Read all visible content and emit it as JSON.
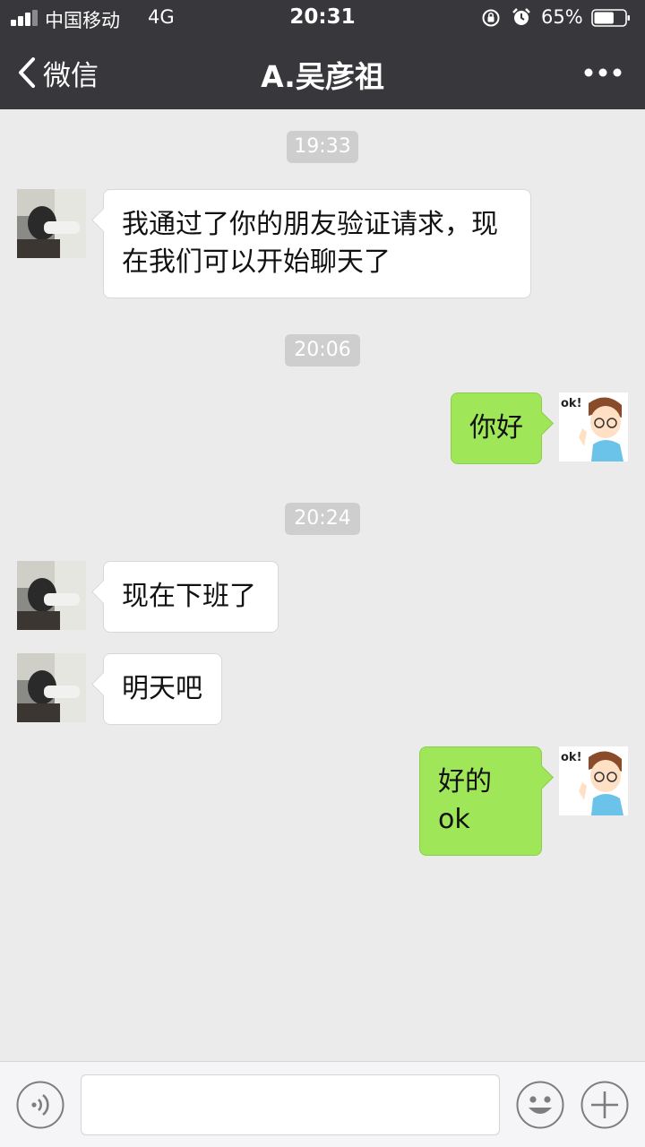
{
  "status_bar": {
    "carrier": "中国移动",
    "network": "4G",
    "time": "20:31",
    "battery_percent": "65%",
    "battery_level": 0.65,
    "signal_bars": 3
  },
  "nav": {
    "back_label": "微信",
    "title": "A.吴彦祖",
    "more_icon": "more-dots-icon"
  },
  "messages": [
    {
      "type": "timestamp",
      "text": "19:33"
    },
    {
      "type": "incoming",
      "text": "我通过了你的朋友验证请求，现在我们可以开始聊天了"
    },
    {
      "type": "timestamp",
      "text": "20:06"
    },
    {
      "type": "outgoing",
      "text": "你好"
    },
    {
      "type": "timestamp",
      "text": "20:24"
    },
    {
      "type": "incoming",
      "text": "现在下班了"
    },
    {
      "type": "incoming",
      "text": "明天吧"
    },
    {
      "type": "outgoing",
      "text": "好的ok"
    }
  ],
  "avatar_right_caption": "ok!",
  "input_bar": {
    "voice_icon": "voice-icon",
    "emoji_icon": "emoji-icon",
    "plus_icon": "plus-icon",
    "value": ""
  },
  "colors": {
    "header_bg": "#38383c",
    "chat_bg": "#ebebeb",
    "outgoing_bubble": "#9fe658",
    "incoming_bubble": "#ffffff"
  }
}
